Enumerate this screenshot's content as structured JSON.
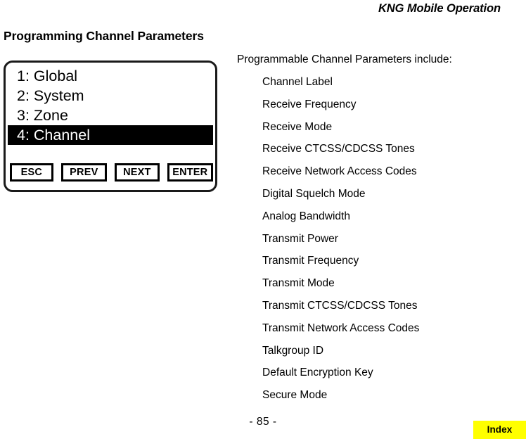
{
  "page": {
    "running_header": "KNG Mobile Operation",
    "section_title": "Programming Channel Parameters",
    "page_number": "- 85 -",
    "accent_color": "#ffff00"
  },
  "lcd": {
    "menu_items": [
      {
        "label": "1: Global",
        "selected": false
      },
      {
        "label": "2: System",
        "selected": false
      },
      {
        "label": "3: Zone",
        "selected": false
      },
      {
        "label": "4: Channel",
        "selected": true
      }
    ],
    "softkeys": [
      {
        "label": "ESC"
      },
      {
        "label": "PREV"
      },
      {
        "label": "NEXT"
      },
      {
        "label": "ENTER"
      }
    ]
  },
  "parameters": {
    "intro": "Programmable Channel Parameters include:",
    "items": [
      "Channel Label",
      "Receive Frequency",
      "Receive Mode",
      "Receive CTCSS/CDCSS Tones",
      "Receive Network Access Codes",
      "Digital Squelch Mode",
      "Analog Bandwidth",
      "Transmit Power",
      "Transmit Frequency",
      "Transmit Mode",
      "Transmit CTCSS/CDCSS Tones",
      "Transmit Network Access Codes",
      "Talkgroup ID",
      "Default Encryption Key",
      "Secure Mode"
    ]
  },
  "index_tab": {
    "label": "Index"
  }
}
